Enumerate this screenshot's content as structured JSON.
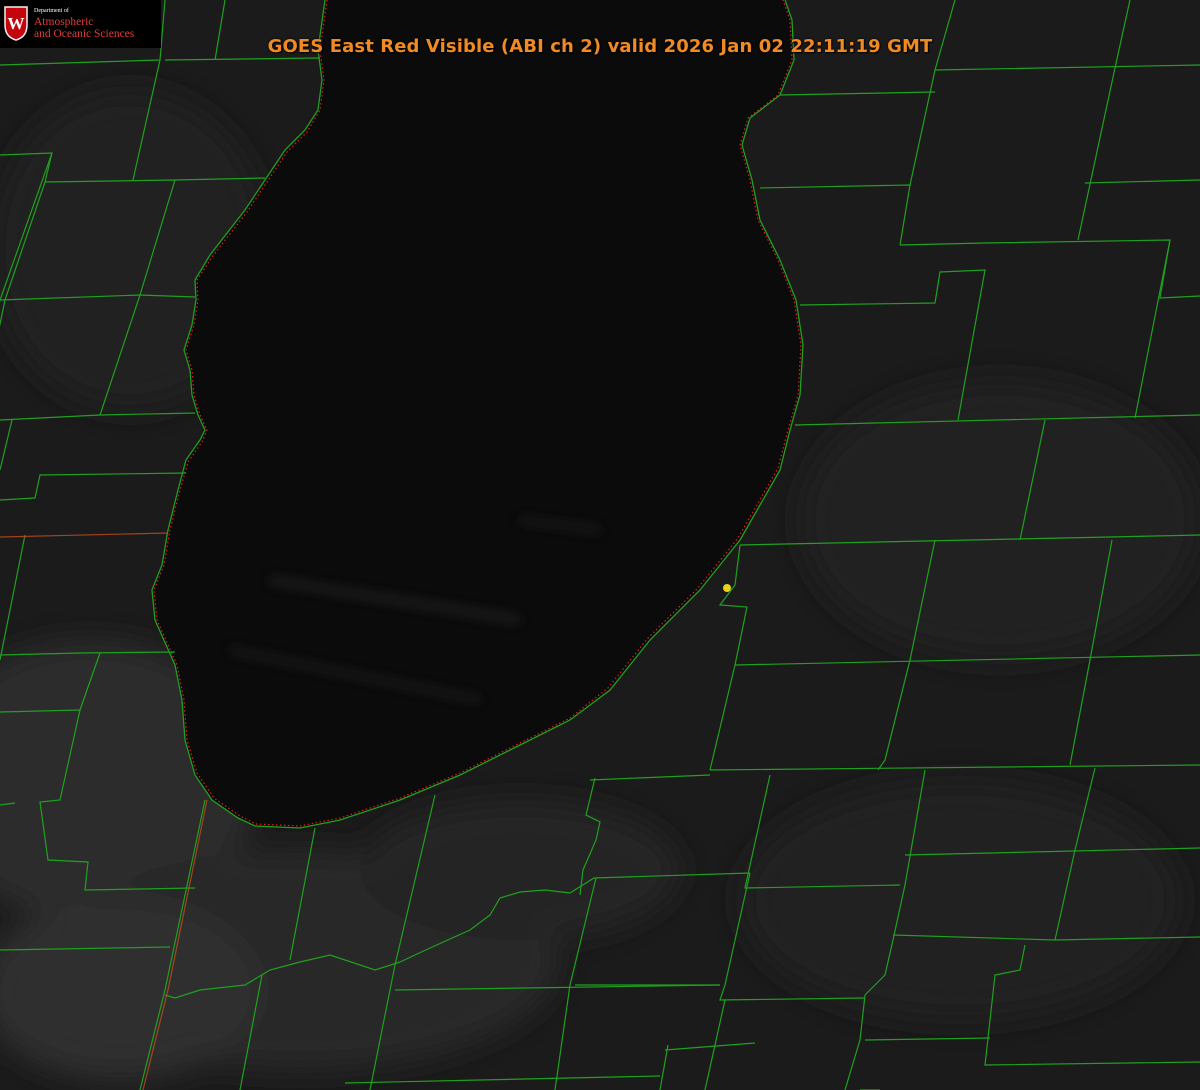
{
  "image": {
    "title": "GOES East Red Visible (ABI ch 2) valid 2026 Jan 02 22:11:19 GMT",
    "satellite": "GOES East",
    "band": "Red Visible (ABI ch 2)",
    "valid_time": "2026 Jan 02 22:11:19 GMT"
  },
  "logo": {
    "dept_line": "Department of",
    "name_line1": "Atmospheric",
    "name_line2": "and Oceanic Sciences",
    "crest_letter": "W"
  },
  "map": {
    "colors": {
      "background": "#1b1b1b",
      "lake": "#0b0b0b",
      "county_lines": "#1fa11f",
      "shoreline_dotted": "#e02020",
      "state_line": "#b84a1a",
      "point_marker": "#e8d21e",
      "title": "#f08a24"
    },
    "features": [
      "lake",
      "shoreline",
      "county-boundaries",
      "state-boundary",
      "point-marker"
    ]
  }
}
